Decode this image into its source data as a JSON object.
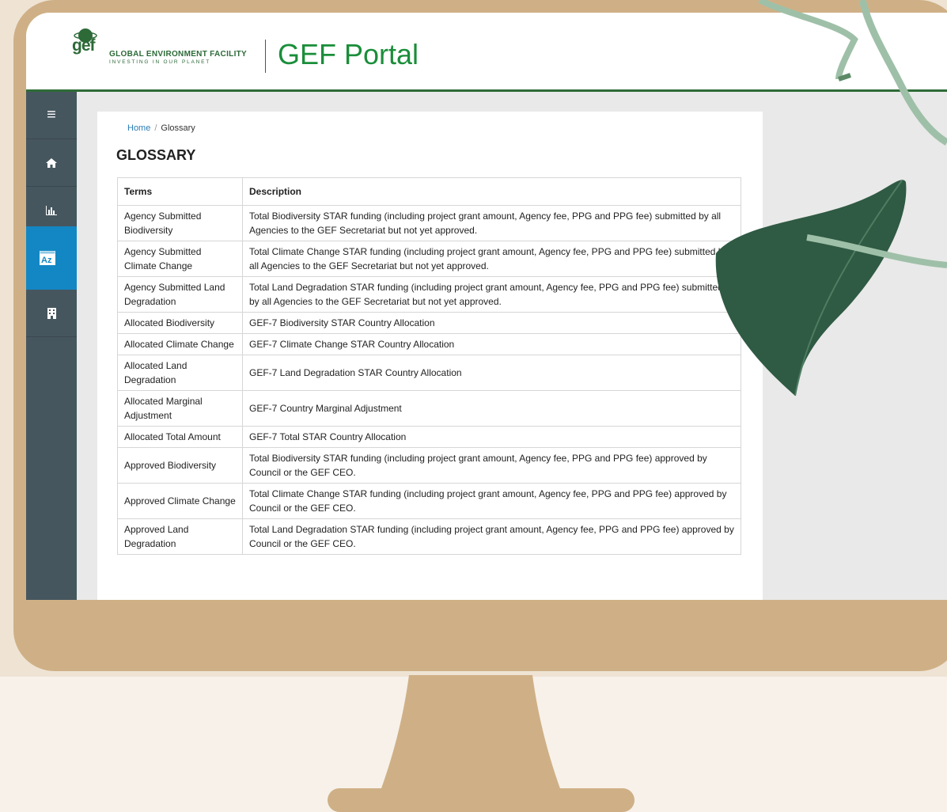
{
  "header": {
    "logo_text": "gef",
    "org_name": "GLOBAL ENVIRONMENT FACILITY",
    "org_tagline": "INVESTING IN OUR PLANET",
    "portal_title": "GEF Portal"
  },
  "sidebar": {
    "items": [
      {
        "icon": "menu-icon",
        "glyph": "≡"
      },
      {
        "icon": "home-icon",
        "glyph": "⌂"
      },
      {
        "icon": "bar-chart-icon",
        "glyph": "📊"
      },
      {
        "icon": "glossary-az-icon",
        "glyph": "AZ"
      },
      {
        "icon": "building-icon",
        "glyph": "▦"
      }
    ]
  },
  "breadcrumb": {
    "home": "Home",
    "separator": "/",
    "current": "Glossary"
  },
  "page": {
    "title": "GLOSSARY"
  },
  "table": {
    "headers": {
      "terms": "Terms",
      "description": "Description"
    },
    "rows": [
      {
        "term": "Agency Submitted Biodiversity",
        "desc": "Total Biodiversity STAR funding (including project grant amount, Agency fee, PPG and PPG fee) submitted by all Agencies to the GEF Secretariat but not yet approved."
      },
      {
        "term": "Agency Submitted Climate Change",
        "desc": "Total Climate Change STAR funding (including project grant amount, Agency fee, PPG and PPG fee) submitted by all Agencies to the GEF Secretariat but not yet approved."
      },
      {
        "term": "Agency Submitted Land Degradation",
        "desc": "Total Land Degradation STAR funding (including project grant amount, Agency fee, PPG and PPG fee) submitted by all Agencies to the GEF Secretariat but not yet approved."
      },
      {
        "term": "Allocated Biodiversity",
        "desc": "GEF-7 Biodiversity STAR Country Allocation"
      },
      {
        "term": "Allocated Climate Change",
        "desc": "GEF-7 Climate Change STAR Country Allocation"
      },
      {
        "term": "Allocated Land Degradation",
        "desc": "GEF-7 Land Degradation STAR Country Allocation"
      },
      {
        "term": "Allocated Marginal Adjustment",
        "desc": "GEF-7 Country Marginal Adjustment"
      },
      {
        "term": "Allocated Total Amount",
        "desc": "GEF-7 Total STAR Country Allocation"
      },
      {
        "term": "Approved Biodiversity",
        "desc": "Total Biodiversity STAR funding (including project grant amount, Agency fee, PPG and PPG fee) approved by Council or the GEF CEO."
      },
      {
        "term": "Approved Climate Change",
        "desc": "Total Climate Change STAR funding (including project grant amount, Agency fee, PPG and PPG fee) approved by Council or the GEF CEO."
      },
      {
        "term": "Approved Land Degradation",
        "desc": "Total Land Degradation STAR funding (including project grant amount, Agency fee, PPG and PPG fee) approved by Council or the GEF CEO."
      }
    ]
  },
  "colors": {
    "brand_green": "#1a8e3a",
    "sidebar": "#46565f",
    "active": "#1387c4",
    "monitor": "#cfb086"
  }
}
